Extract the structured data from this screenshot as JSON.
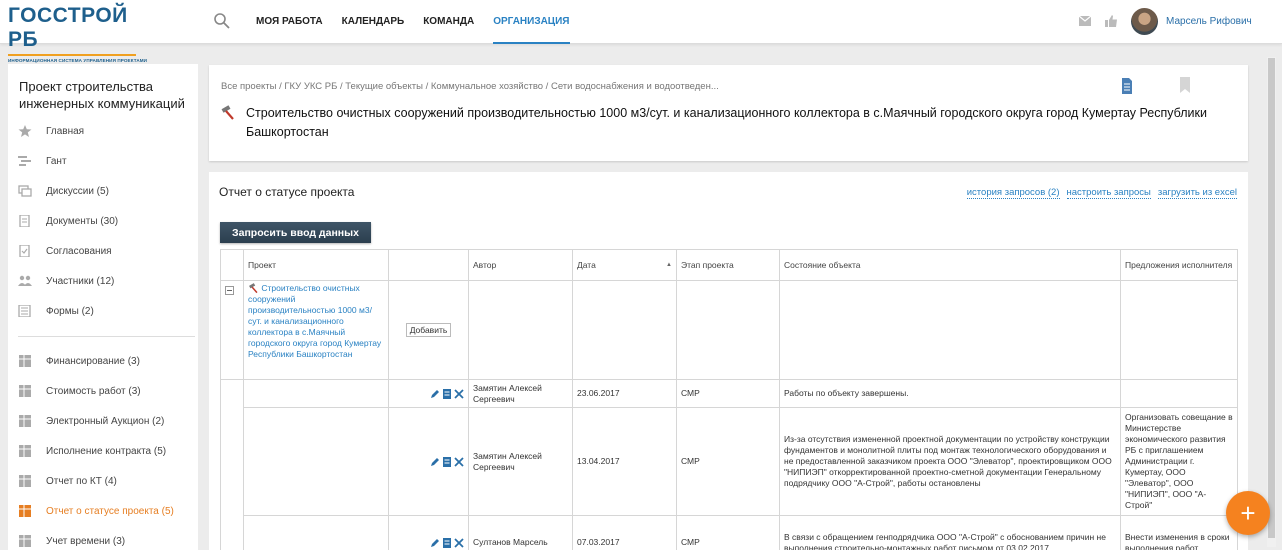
{
  "logo": {
    "title": "ГОССТРОЙ РБ",
    "subtitle": "ИНФОРМАЦИОННАЯ СИСТЕМА УПРАВЛЕНИЯ ПРОЕКТАМИ"
  },
  "nav": {
    "items": [
      "МОЯ РАБОТА",
      "КАЛЕНДАРЬ",
      "КОМАНДА",
      "ОРГАНИЗАЦИЯ"
    ],
    "active": "ОРГАНИЗАЦИЯ"
  },
  "user": {
    "name": "Марсель Рифович"
  },
  "sidebar": {
    "title": "Проект строительства инженерных коммуникаций",
    "items": [
      {
        "label": "Главная",
        "icon": "star-icon"
      },
      {
        "label": "Гант",
        "icon": "gantt-icon"
      },
      {
        "label": "Дискуссии (5)",
        "icon": "chat-icon"
      },
      {
        "label": "Документы (30)",
        "icon": "document-icon"
      },
      {
        "label": "Согласования",
        "icon": "approval-icon"
      },
      {
        "label": "Участники (12)",
        "icon": "people-icon"
      },
      {
        "label": "Формы (2)",
        "icon": "form-icon"
      }
    ],
    "items2": [
      {
        "label": "Финансирование (3)",
        "icon": "table-icon"
      },
      {
        "label": "Стоимость работ (3)",
        "icon": "table-icon"
      },
      {
        "label": "Электронный Аукцион (2)",
        "icon": "table-icon"
      },
      {
        "label": "Исполнение контракта (5)",
        "icon": "table-icon"
      },
      {
        "label": "Отчет по КТ (4)",
        "icon": "table-icon"
      },
      {
        "label": "Отчет о статусе проекта (5)",
        "icon": "table-icon",
        "active": true
      },
      {
        "label": "Учет времени (3)",
        "icon": "table-icon"
      }
    ]
  },
  "header": {
    "breadcrumb": "Все проекты / ГКУ УКС РБ / Текущие объекты / Коммунальное хозяйство / Сети водоснабжения и водоотведен...",
    "title": "Строительство очистных сооружений производительностью 1000 м3/сут. и канализационного коллектора в с.Маячный городского округа город Кумертау Республики Башкортостан"
  },
  "report": {
    "title": "Отчет о статусе проекта",
    "links": [
      "история запросов (2)",
      "настроить запросы",
      "загрузить из excel"
    ],
    "request_button": "Запросить ввод данных",
    "add_button": "Добавить",
    "columns": [
      "Проект",
      "",
      "Автор",
      "Дата",
      "Этап проекта",
      "Состояние объекта",
      "Предложения исполнителя"
    ],
    "project_link": "Строительство очистных сооружений производительностью 1000 м3/сут. и канализационного коллектора в с.Маячный городского округа город Кумертау Республики Башкортостан",
    "rows": [
      {
        "author": "Замятин Алексей Сергеевич",
        "date": "23.06.2017",
        "stage": "СМР",
        "state": "Работы по объекту завершены.",
        "proposal": ""
      },
      {
        "author": "Замятин Алексей Сергеевич",
        "date": "13.04.2017",
        "stage": "СМР",
        "state": "Из-за отсутствия измененной проектной документации по устройству конструкции фундаментов и монолитной плиты под монтаж технологического оборудования и не предоставленной заказчиком проекта ООО \"Элеватор\", проектировщиком ООО \"НИПИЭП\" откорректированной проектно-сметной документации Генеральному подрядчику ООО \"А-Строй\", работы остановлены",
        "proposal": "Организовать совещание в Министерстве экономического развития РБ с приглашением Администрации г. Кумертау, ООО \"Элеватор\", ООО \"НИПИЭП\", ООО \"А-Строй\""
      },
      {
        "author": "Султанов Марсель",
        "date": "07.03.2017",
        "stage": "СМР",
        "state": "В связи с обращением генподрядчика ООО \"А-Строй\" с обоснованием причин не выполнения строительно-монтажных работ письмом от 03.02.2017",
        "proposal": "Внести изменения в сроки выполнения работ"
      }
    ]
  },
  "fab": "+"
}
